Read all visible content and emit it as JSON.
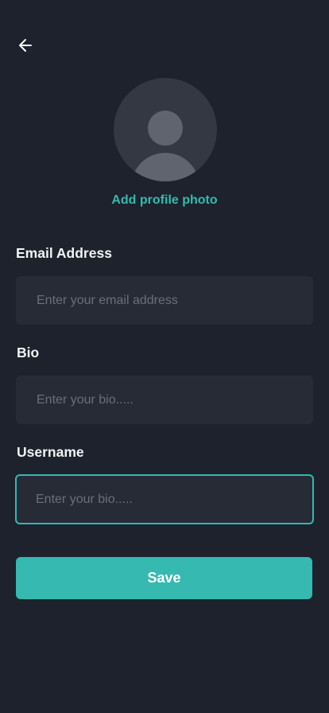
{
  "header": {
    "back_icon": "arrow-left-icon"
  },
  "profile": {
    "avatar_icon": "user-placeholder-icon",
    "add_photo_label": "Add profile photo"
  },
  "form": {
    "email": {
      "label": "Email Address",
      "value": "",
      "placeholder": "Enter your email address"
    },
    "bio": {
      "label": "Bio",
      "value": "",
      "placeholder": "Enter your bio....."
    },
    "username": {
      "label": "Username",
      "value": "",
      "placeholder": "Enter your bio....."
    },
    "save_label": "Save"
  },
  "colors": {
    "background": "#1d222c",
    "input_background": "#272b35",
    "accent": "#35b9b0",
    "text": "#f1f2f4",
    "placeholder": "#6b6f78"
  }
}
